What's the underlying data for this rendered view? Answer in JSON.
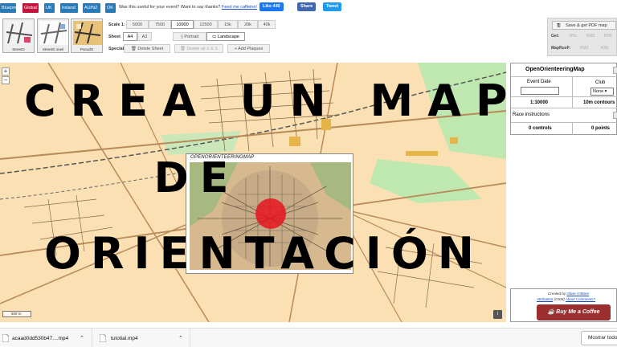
{
  "topbar": {
    "site_buttons": [
      {
        "label": "Blueprint",
        "color": "#2a7ab8"
      },
      {
        "label": "Global",
        "color": "#c0143c"
      },
      {
        "label": "UK",
        "color": "#2a7ab8"
      },
      {
        "label": "Ireland",
        "color": "#2a7ab8"
      },
      {
        "label": "AU/NZ",
        "color": "#2a7ab8"
      },
      {
        "label": "OK",
        "color": "#2a7ab8"
      }
    ],
    "feedback_text": "Was this useful for your event? Want to say thanks?",
    "feedback_link": "Feed me caffeine!",
    "like_label": "Like 440",
    "share_label": "Share",
    "tweet_label": "Tweet"
  },
  "styles": [
    {
      "label": "StreetO"
    },
    {
      "label": "StreetO oneil"
    },
    {
      "label": "PseudO"
    }
  ],
  "controls": {
    "scale_label": "Scale 1:",
    "scales": [
      "5000",
      "7500",
      "10000",
      "12500",
      "15k",
      "20k",
      "40k"
    ],
    "scale_selected": "10000",
    "sheet_label": "Sheet",
    "sheets": [
      "A4",
      "A3"
    ],
    "portrait_label": "Portrait",
    "landscape_label": "Landscape",
    "special_label": "Special",
    "delete_sheet_label": "Delete Sheet",
    "delete_all_label": "Delete all X & S",
    "add_plaques_label": "Add Plaques"
  },
  "pdf_panel": {
    "save_label": "Save & get PDF map",
    "get_label": "Get:",
    "get_options": [
      "JPG",
      "KMZ",
      "PDF"
    ],
    "mapruntf_label": "MapRunF:",
    "mapruntf_options": [
      "KMZ",
      "KML"
    ]
  },
  "map": {
    "overlay_line1": "CREA UN MAPA",
    "overlay_line2": "DE",
    "overlay_line3": "ORIENTACIÓN",
    "inset_title": "OPENORIENTEERINGMAP",
    "zoom_in": "+",
    "zoom_out": "−",
    "scale_text": "500 m",
    "info_label": "i"
  },
  "right_panel": {
    "title": "OpenOrienteeringMap",
    "event_date_label": "Event Date",
    "club_label": "Club",
    "club_value": "None",
    "scale_value": "1:10000",
    "contour_value": "10m contours",
    "race_instructions": "Race instructions",
    "controls_count": "0 controls",
    "points_count": "0 points"
  },
  "credits": {
    "line1_prefix": "Created by",
    "line1_name": "Oliver O'Brien",
    "line2_attr": "Attribution",
    "line2_mid": "(OSM)",
    "line2_comments": "About Comments?",
    "coffee_label": "Buy Me a Coffee"
  },
  "downloads": [
    {
      "name": "acaad0dd530b47....mp4"
    },
    {
      "name": "tutotial.mp4"
    }
  ],
  "show_all_label": "Mostrar todo"
}
